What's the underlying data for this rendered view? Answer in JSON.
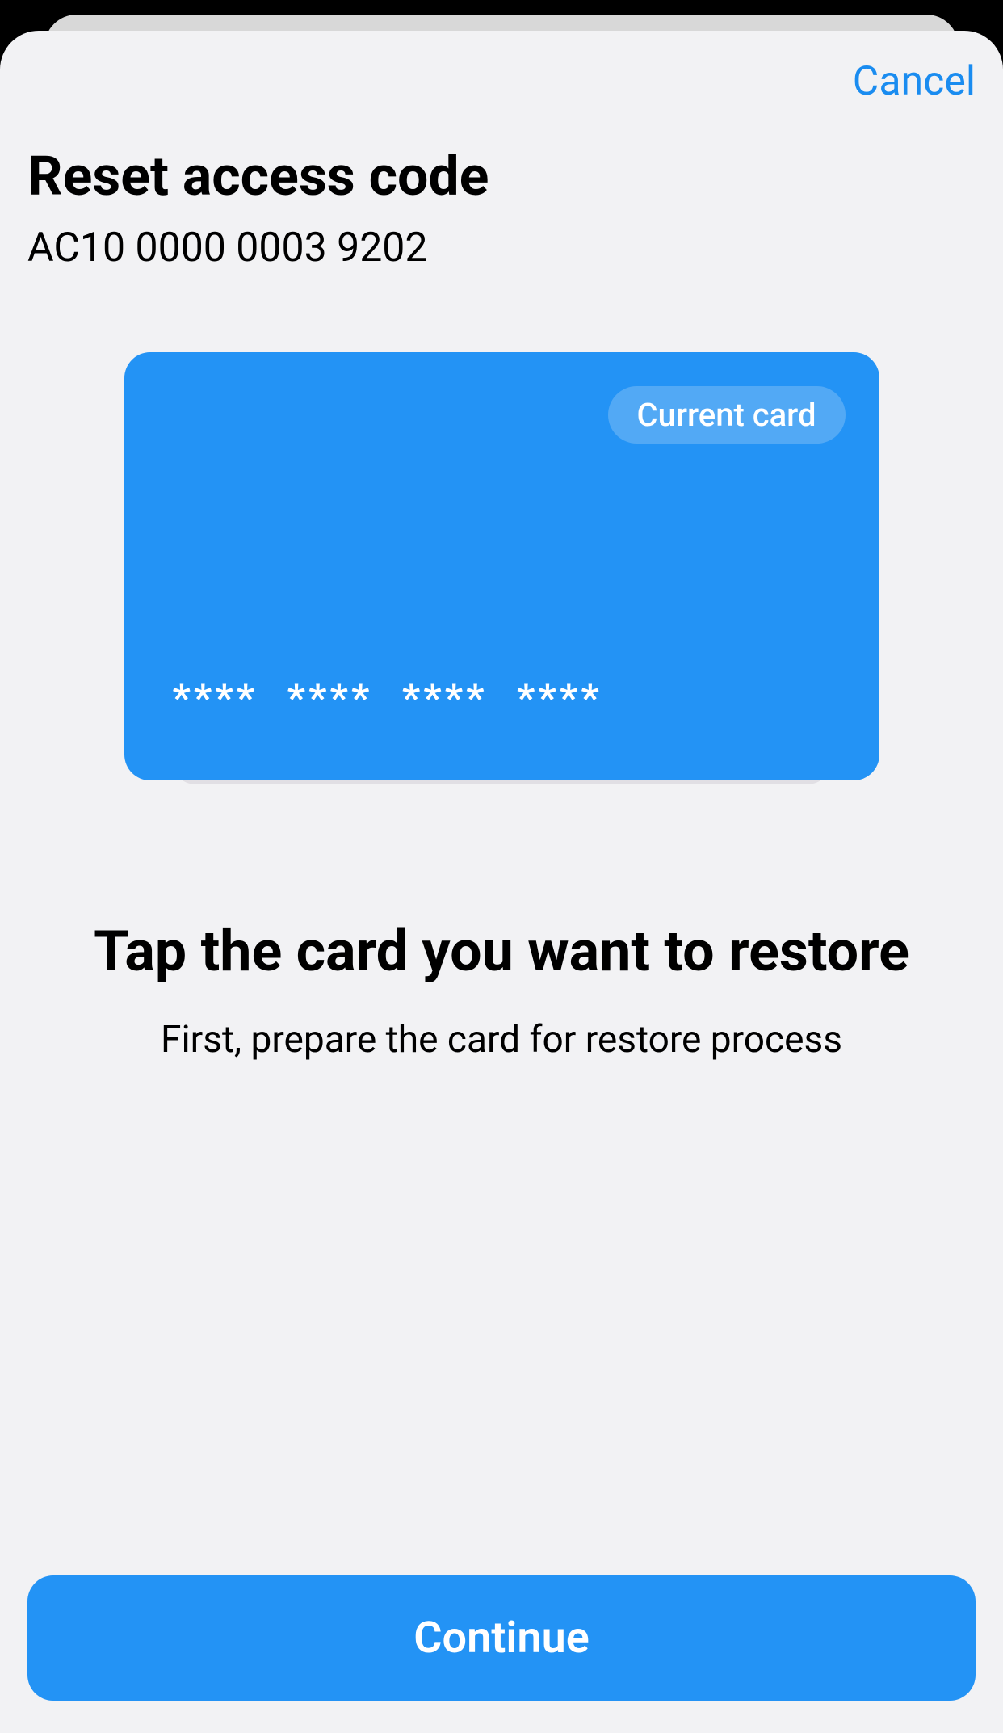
{
  "header": {
    "cancel_label": "Cancel"
  },
  "page": {
    "title": "Reset access code",
    "access_code": "AC10 0000 0003 9202"
  },
  "card": {
    "badge_label": "Current card",
    "masked_number": "**** **** **** ****"
  },
  "instruction": {
    "title": "Tap the card you want to restore",
    "subtitle": "First, prepare the card for restore process"
  },
  "footer": {
    "continue_label": "Continue"
  },
  "colors": {
    "accent": "#2393f5",
    "link": "#1a8cf0",
    "background": "#f2f2f4"
  }
}
